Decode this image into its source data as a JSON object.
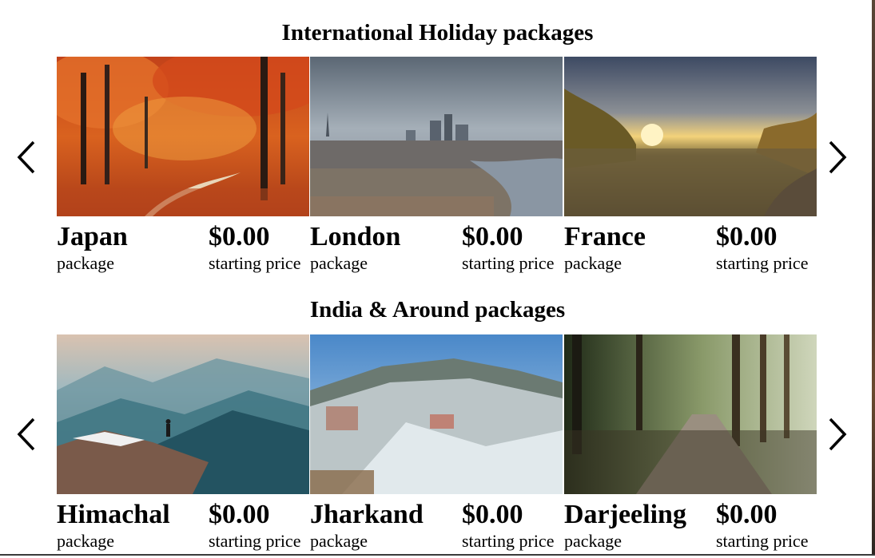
{
  "international": {
    "title": "International Holiday packages",
    "prev_icon": "chevron-left-icon",
    "next_icon": "chevron-right-icon",
    "cards": [
      {
        "name": "Japan",
        "subtitle": "package",
        "price": "$0.00",
        "price_label": "starting price",
        "image": "autumn-forest-photo"
      },
      {
        "name": "London",
        "subtitle": "package",
        "price": "$0.00",
        "price_label": "starting price",
        "image": "london-skyline-photo"
      },
      {
        "name": "France",
        "subtitle": "package",
        "price": "$0.00",
        "price_label": "starting price",
        "image": "river-sunset-photo"
      }
    ]
  },
  "india": {
    "title": "India & Around packages",
    "prev_icon": "chevron-left-icon",
    "next_icon": "chevron-right-icon",
    "cards": [
      {
        "name": "Himachal",
        "subtitle": "package",
        "price": "$0.00",
        "price_label": "starting price",
        "image": "misty-mountains-photo"
      },
      {
        "name": "Jharkand",
        "subtitle": "package",
        "price": "$0.00",
        "price_label": "starting price",
        "image": "snowy-hill-town-photo"
      },
      {
        "name": "Darjeeling",
        "subtitle": "package",
        "price": "$0.00",
        "price_label": "starting price",
        "image": "forest-path-photo"
      }
    ]
  }
}
